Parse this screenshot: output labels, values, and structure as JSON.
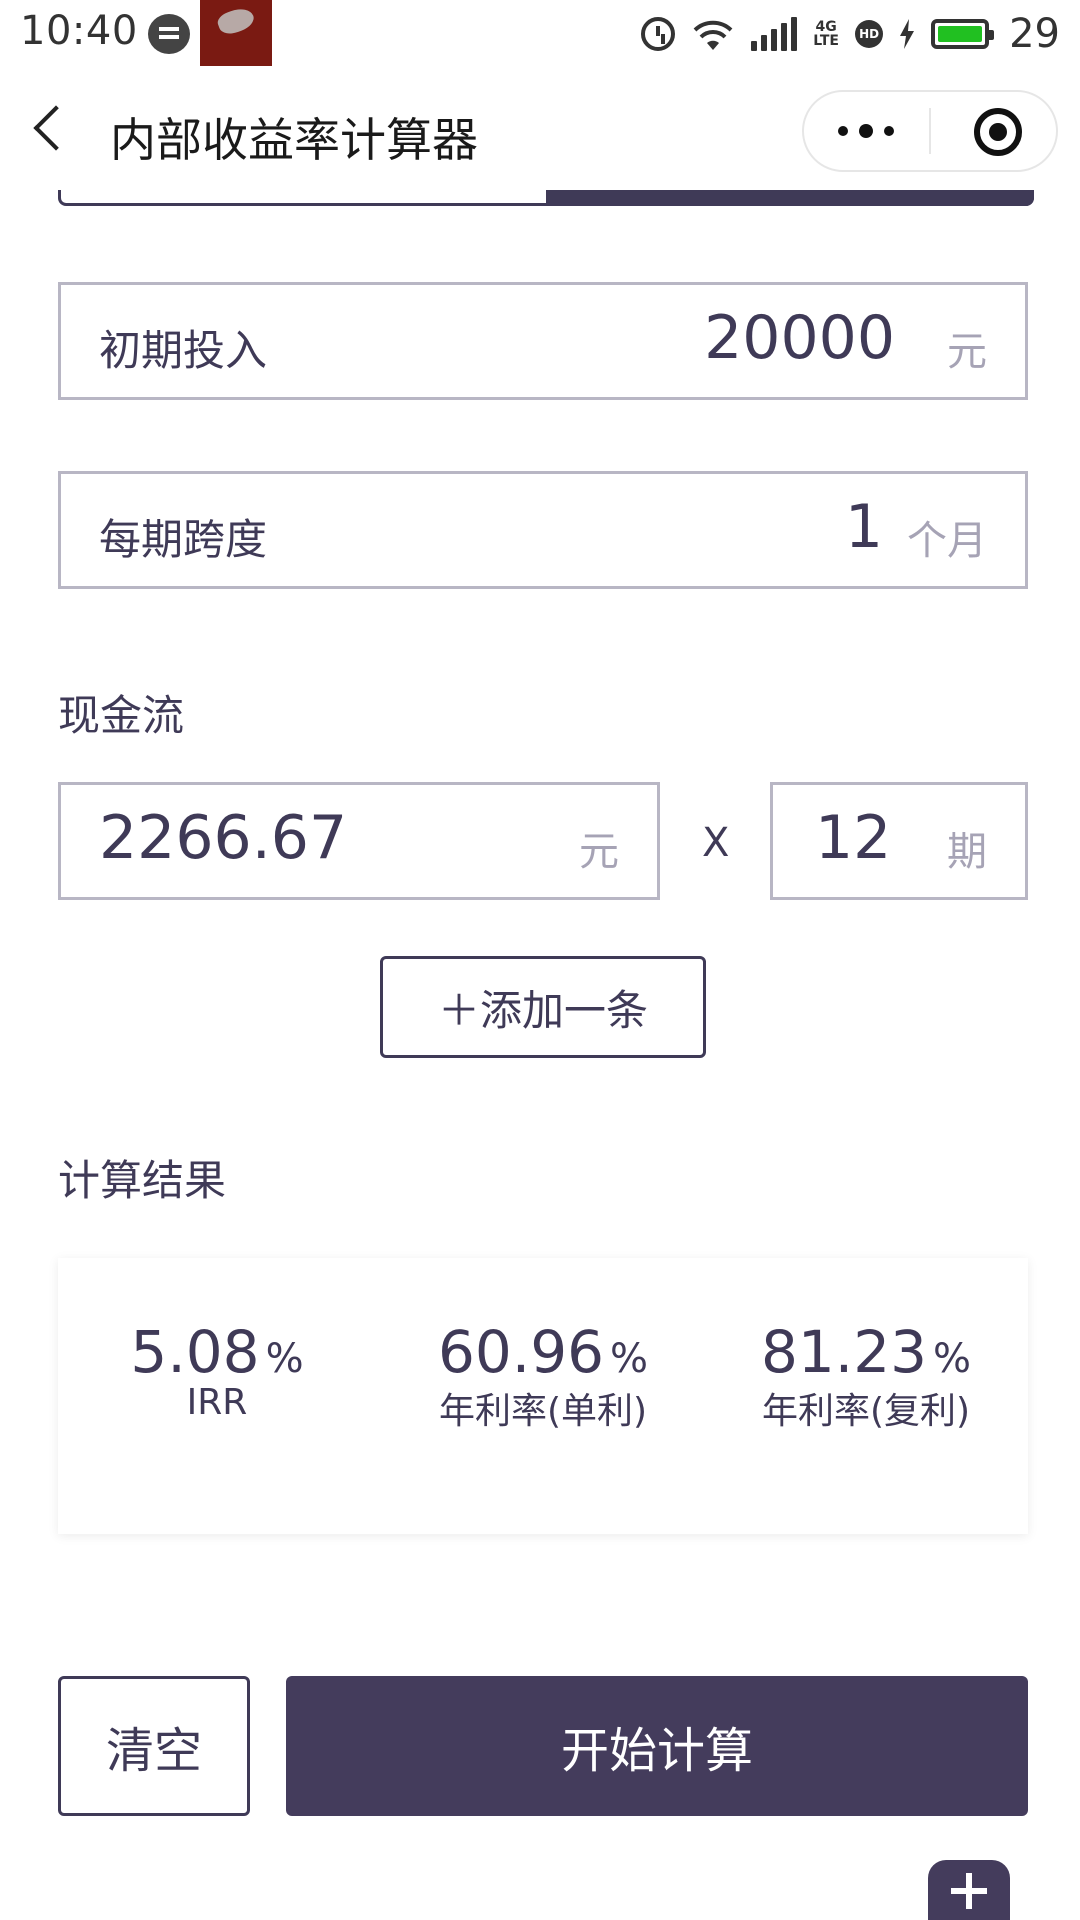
{
  "status_bar": {
    "time": "10:40",
    "battery_level": "29",
    "network": "4G LTE",
    "hd_badge": "HD",
    "icons": [
      "chat-bubble-icon",
      "notification-thumbnail",
      "alarm-icon",
      "wifi-icon",
      "signal-icon",
      "4g-lte-icon",
      "hd-icon",
      "charging-icon",
      "battery-icon"
    ]
  },
  "nav": {
    "title": "内部收益率计算器",
    "back_icon": "chevron-left-icon",
    "more_icon": "more-dots-icon",
    "close_icon": "target-close-icon"
  },
  "fields": {
    "initial_investment": {
      "label": "初期投入",
      "value": "20000",
      "unit": "元"
    },
    "period_span": {
      "label": "每期跨度",
      "value": "1",
      "unit": "个月"
    }
  },
  "cash_flow": {
    "label": "现金流",
    "rows": [
      {
        "amount": "2266.67",
        "amount_unit": "元",
        "times": "X",
        "periods": "12",
        "periods_unit": "期"
      }
    ],
    "add_button": "＋添加一条"
  },
  "results": {
    "label": "计算结果",
    "items": [
      {
        "value": "5.08",
        "unit": "%",
        "caption": "IRR"
      },
      {
        "value": "60.96",
        "unit": "%",
        "caption": "年利率(单利)"
      },
      {
        "value": "81.23",
        "unit": "%",
        "caption": "年利率(复利)"
      }
    ]
  },
  "actions": {
    "clear": "清空",
    "calculate": "开始计算"
  },
  "colors": {
    "primary": "#443c5c",
    "text": "#3f3a57",
    "border": "#b8b6c4",
    "unit_text": "#a6a3b5",
    "battery": "#21c021"
  }
}
